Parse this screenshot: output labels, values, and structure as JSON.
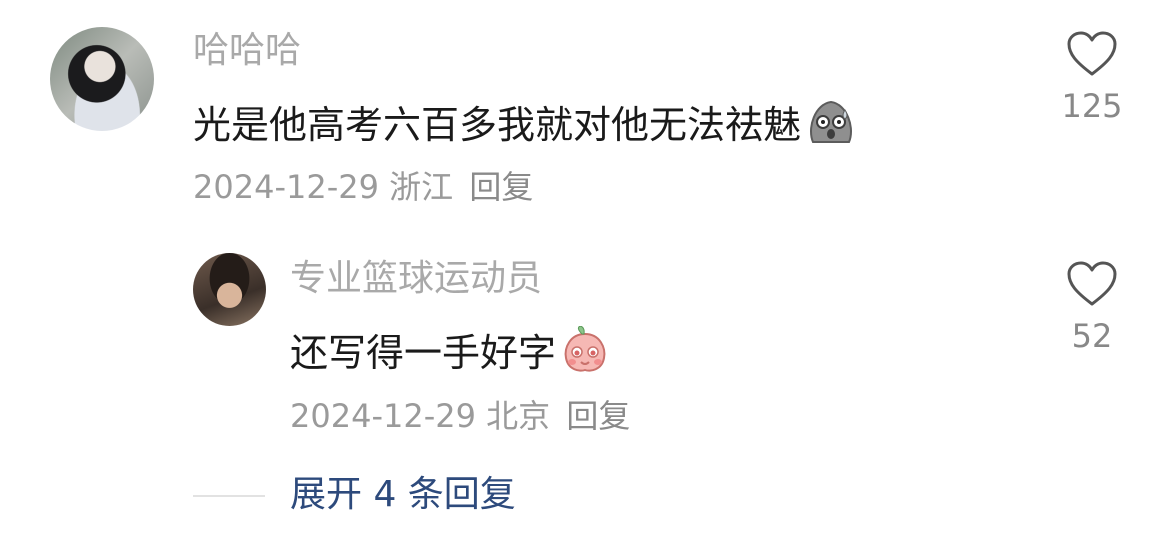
{
  "comments": [
    {
      "username": "哈哈哈",
      "text": "光是他高考六百多我就对他无法祛魅",
      "emoji": "sweating-blob-emoji",
      "date": "2024-12-29",
      "location": "浙江",
      "reply_label": "回复",
      "likes": "125"
    }
  ],
  "replies": [
    {
      "username": "专业篮球运动员",
      "text": "还写得一手好字",
      "emoji": "peach-pleading-emoji",
      "date": "2024-12-29",
      "location": "北京",
      "reply_label": "回复",
      "likes": "52"
    }
  ],
  "expand_replies": "展开 4 条回复",
  "colors": {
    "link": "#2d4a7c",
    "muted": "#a9a9a9",
    "text": "#1a1a1a"
  }
}
